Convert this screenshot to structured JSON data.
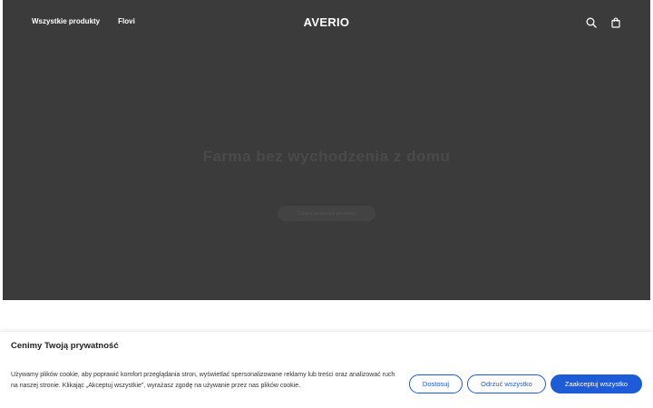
{
  "header": {
    "nav": [
      {
        "label": "Wszystkie produkty"
      },
      {
        "label": "Flovi"
      }
    ],
    "logo": "AVERIO",
    "icons": {
      "search": "search-icon",
      "cart": "shopping-bag-icon"
    }
  },
  "hero": {
    "title": "Farma bez wychodzenia z domu",
    "button_label": "Zobacz wszystkie produkty",
    "background_color": "#3b3b3b"
  },
  "cookie_banner": {
    "title": "Cenimy Twoją prywatność",
    "text": "Używamy plików cookie, aby poprawić komfort przeglądania stron, wyświetlać spersonalizowane reklamy lub treści oraz analizować ruch na naszej stronie. Klikając „Akceptuj wszystkie”, wyrażasz zgodę na używanie przez nas plików cookie.",
    "buttons": {
      "customize": "Dostosuj",
      "reject": "Odrzuć wszystko",
      "accept": "Zaakceptuj wszystko"
    },
    "accent_color": "#1e5bd6"
  }
}
